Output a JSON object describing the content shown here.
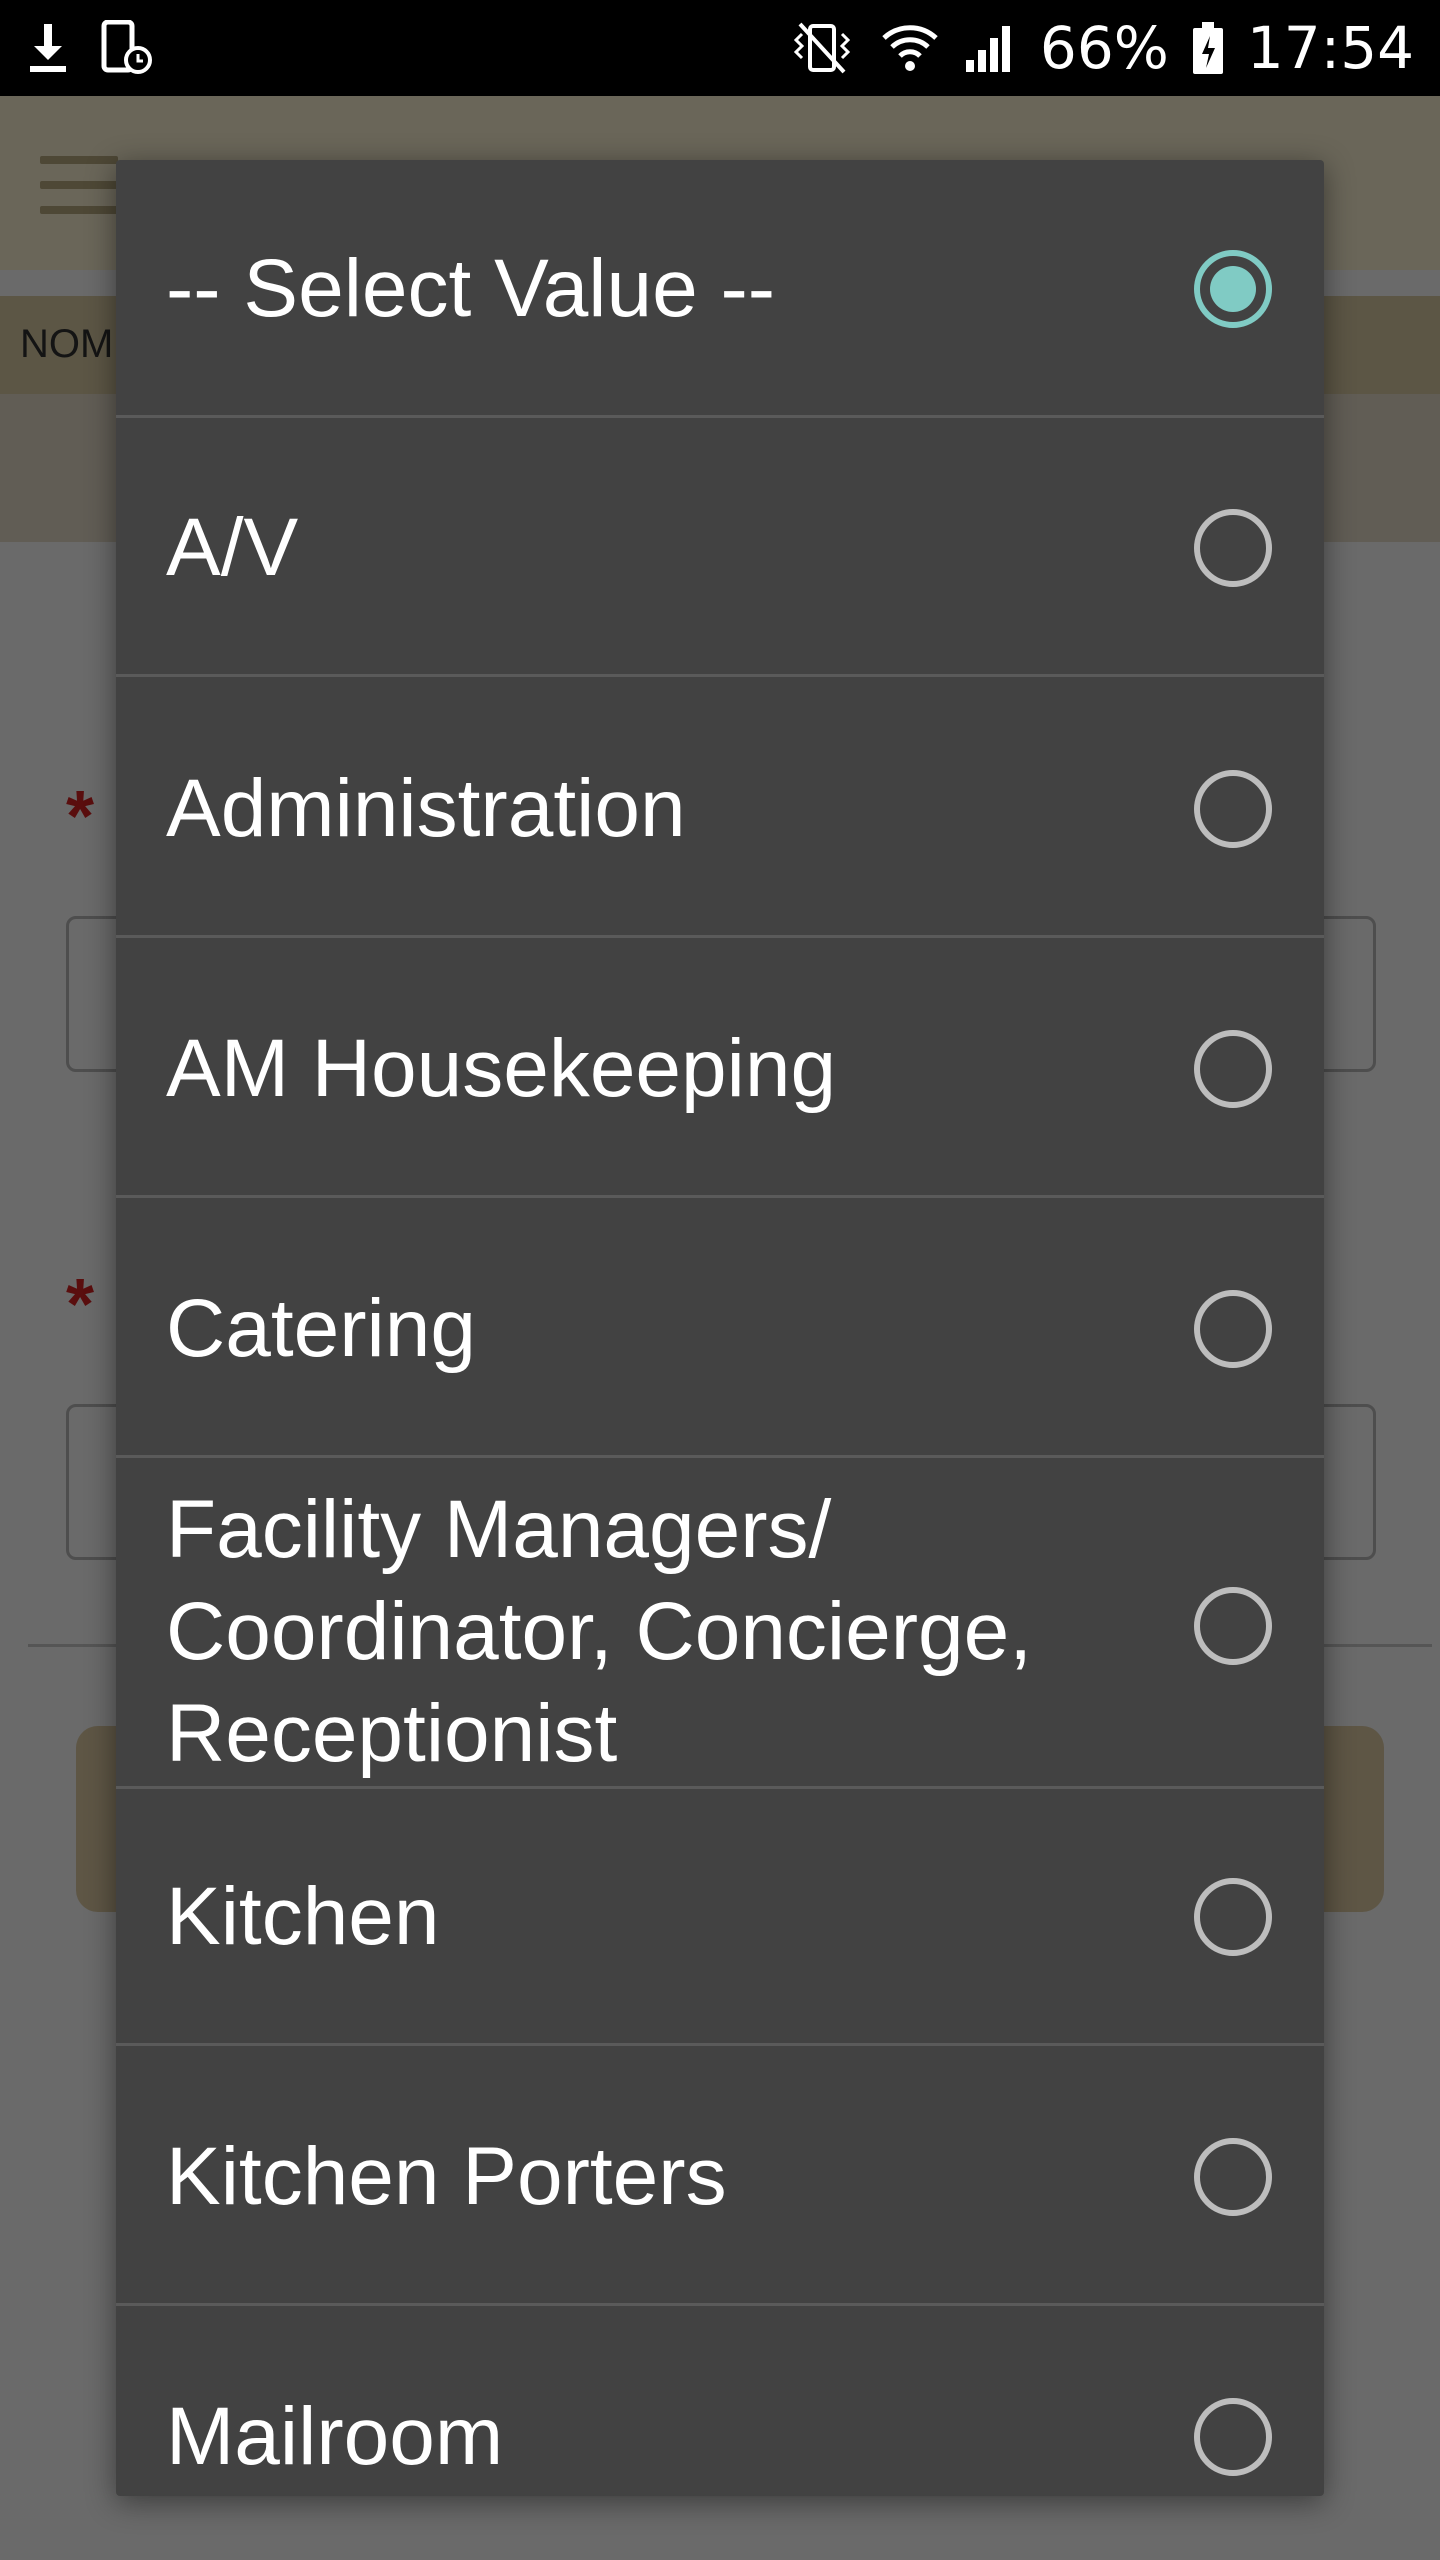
{
  "status_bar": {
    "battery": "66%",
    "time": "17:54",
    "left_icons": [
      "download-icon",
      "device-clock-icon"
    ],
    "right_icons": [
      "vibrate-mute-icon",
      "wifi-icon",
      "signal-icon",
      "battery-charging-icon"
    ]
  },
  "background": {
    "subbar_text": "NOM"
  },
  "dialog": {
    "accent_color": "#80cbc4",
    "options": [
      {
        "label": "-- Select Value --",
        "selected": true
      },
      {
        "label": "A/V",
        "selected": false
      },
      {
        "label": "Administration",
        "selected": false
      },
      {
        "label": "AM Housekeeping",
        "selected": false
      },
      {
        "label": "Catering",
        "selected": false
      },
      {
        "label": "Facility Managers/ Coordinator, Concierge, Receptionist",
        "selected": false
      },
      {
        "label": "Kitchen",
        "selected": false
      },
      {
        "label": "Kitchen Porters",
        "selected": false
      },
      {
        "label": "Mailroom",
        "selected": false
      }
    ]
  }
}
